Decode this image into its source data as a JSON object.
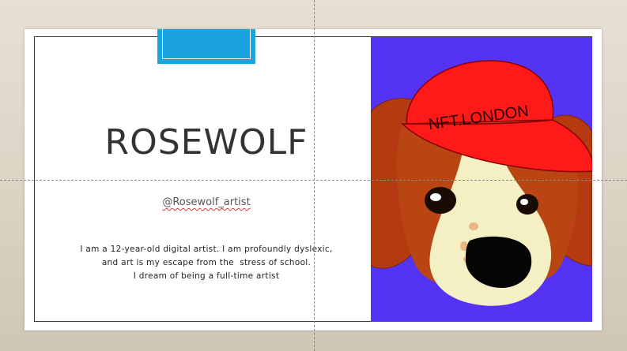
{
  "slide": {
    "title": "ROSEWOLF",
    "handle": "@Rosewolf_artist",
    "bio_lines": [
      "I am a 12-year-old digital artist. I am profoundly dyslexic,",
      "and art is my escape from the  stress of school.",
      "I dream of being a full-time artist"
    ]
  },
  "artwork": {
    "cap_text": "NFT.LONDON",
    "background_color": "#5533f5",
    "cap_color": "#ff1a1a"
  },
  "colors": {
    "accent": "#1aa3df",
    "canvas": "#ddd6c7"
  }
}
